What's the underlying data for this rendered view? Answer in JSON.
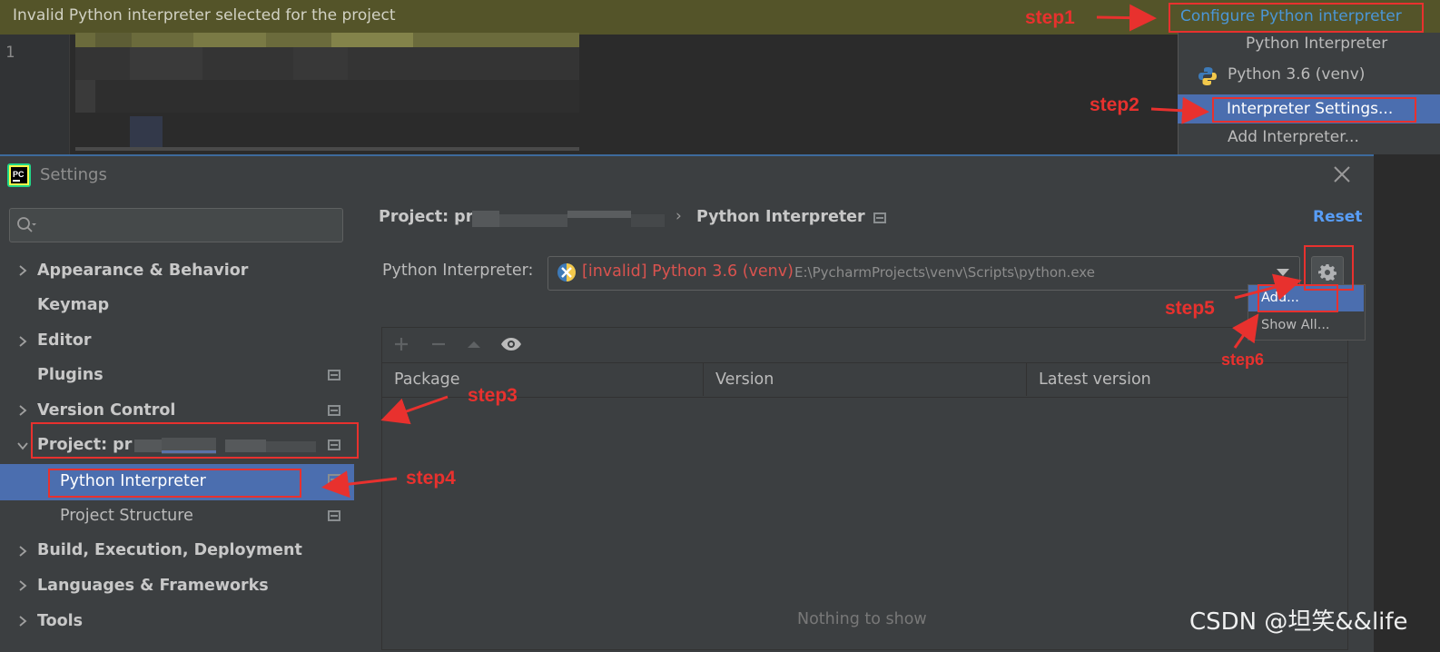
{
  "banner": {
    "message": "Invalid Python interpreter selected for the project",
    "configure_link": "Configure Python interpreter"
  },
  "editor": {
    "line_number": "1"
  },
  "interpreter_popup": {
    "title": "Python Interpreter",
    "items": [
      "Python 3.6 (venv)",
      "Interpreter Settings...",
      "Add Interpreter..."
    ],
    "selected": "Interpreter Settings..."
  },
  "dialog": {
    "title": "Settings",
    "app_icon": "pycharm-icon",
    "search": {
      "value": ""
    },
    "sidebar": {
      "items": [
        {
          "label": "Appearance & Behavior",
          "expandable": true
        },
        {
          "label": "Keymap",
          "expandable": false
        },
        {
          "label": "Editor",
          "expandable": true
        },
        {
          "label": "Plugins",
          "expandable": false
        },
        {
          "label": "Version Control",
          "expandable": true
        },
        {
          "label": "Project: pr",
          "expandable": true,
          "expanded": true
        },
        {
          "label": "Python Interpreter",
          "child": true,
          "selected": true
        },
        {
          "label": "Project Structure",
          "child": true
        },
        {
          "label": "Build, Execution, Deployment",
          "expandable": true
        },
        {
          "label": "Languages & Frameworks",
          "expandable": true
        },
        {
          "label": "Tools",
          "expandable": true
        }
      ]
    },
    "breadcrumb": {
      "project": "Project: pr",
      "separator": "›",
      "current": "Python Interpreter"
    },
    "reset_label": "Reset",
    "interpreter": {
      "label": "Python Interpreter:",
      "invalid_name": "[invalid] Python 3.6 (venv)",
      "path": "E:\\PycharmProjects\\venv\\Scripts\\python.exe"
    },
    "gear_menu": {
      "items": [
        "Add...",
        "Show All..."
      ],
      "selected": "Add..."
    },
    "packages": {
      "columns": [
        "Package",
        "Version",
        "Latest version"
      ],
      "rows": [],
      "empty_text": "Nothing to show"
    }
  },
  "annotations": {
    "steps": [
      "step1",
      "step2",
      "step3",
      "step4",
      "step5",
      "step6"
    ],
    "color": "#e8312e"
  },
  "watermark": "CSDN @坦笑&&life",
  "colors": {
    "selection": "#4b6eaf",
    "invalid": "#d9534f",
    "link": "#589df6",
    "banner": "#545429"
  }
}
